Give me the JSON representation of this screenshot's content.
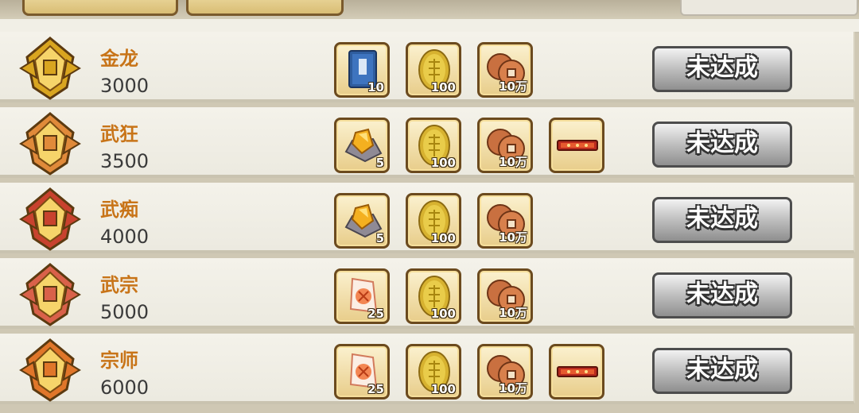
{
  "tabs": [
    "",
    ""
  ],
  "ranks": [
    {
      "name": "金龙",
      "score": "3000",
      "badge": "golden-dragon-badge-icon",
      "badge_color": "#d9a520",
      "rewards": [
        {
          "icon": "blue-book-icon",
          "qty": "10"
        },
        {
          "icon": "gold-coin-icon",
          "qty": "100"
        },
        {
          "icon": "copper-coins-icon",
          "qty": "10万"
        }
      ],
      "status": "未达成"
    },
    {
      "name": "武狂",
      "score": "3500",
      "badge": "wukuang-badge-icon",
      "badge_color": "#e08a3a",
      "rewards": [
        {
          "icon": "gold-ore-icon",
          "qty": "5"
        },
        {
          "icon": "gold-coin-icon",
          "qty": "100"
        },
        {
          "icon": "copper-coins-icon",
          "qty": "10万"
        },
        {
          "icon": "title-banner-icon",
          "qty": ""
        }
      ],
      "status": "未达成"
    },
    {
      "name": "武痴",
      "score": "4000",
      "badge": "wuchi-badge-icon",
      "badge_color": "#c8422e",
      "rewards": [
        {
          "icon": "gold-ore-icon",
          "qty": "5"
        },
        {
          "icon": "gold-coin-icon",
          "qty": "100"
        },
        {
          "icon": "copper-coins-icon",
          "qty": "10万"
        }
      ],
      "status": "未达成"
    },
    {
      "name": "武宗",
      "score": "5000",
      "badge": "wuzong-badge-icon",
      "badge_color": "#d9614a",
      "rewards": [
        {
          "icon": "talisman-crystal-icon",
          "qty": "25"
        },
        {
          "icon": "gold-coin-icon",
          "qty": "100"
        },
        {
          "icon": "copper-coins-icon",
          "qty": "10万"
        }
      ],
      "status": "未达成"
    },
    {
      "name": "宗师",
      "score": "6000",
      "badge": "zongshi-badge-icon",
      "badge_color": "#e0762a",
      "rewards": [
        {
          "icon": "talisman-crystal-icon",
          "qty": "25"
        },
        {
          "icon": "gold-coin-icon",
          "qty": "100"
        },
        {
          "icon": "copper-coins-icon",
          "qty": "10万"
        },
        {
          "icon": "title-banner-icon",
          "qty": ""
        }
      ],
      "status": "未达成"
    }
  ]
}
